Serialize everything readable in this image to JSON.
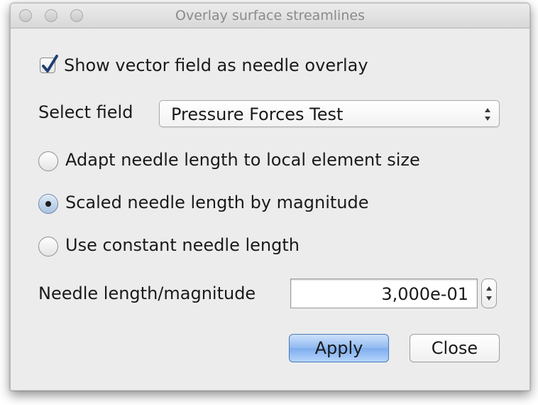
{
  "window": {
    "title": "Overlay surface streamlines"
  },
  "show_overlay": {
    "label": "Show vector field as needle overlay",
    "checked": true
  },
  "field_select": {
    "label": "Select field",
    "value": "Pressure Forces Test"
  },
  "length_mode": {
    "options": [
      {
        "label": "Adapt needle length to local element size",
        "selected": false
      },
      {
        "label": "Scaled needle length by magnitude",
        "selected": true
      },
      {
        "label": "Use constant needle length",
        "selected": false
      }
    ]
  },
  "needle_length": {
    "label": "Needle length/magnitude",
    "value": "3,000e-01"
  },
  "buttons": {
    "apply": "Apply",
    "close": "Close"
  },
  "icons": {
    "check": "checkmark-icon",
    "select_arrows": "chevron-updown-icon",
    "stepper": "stepper-arrows-icon"
  },
  "colors": {
    "default_button": "#8fb9f0",
    "checkmark": "#1f3f73"
  }
}
